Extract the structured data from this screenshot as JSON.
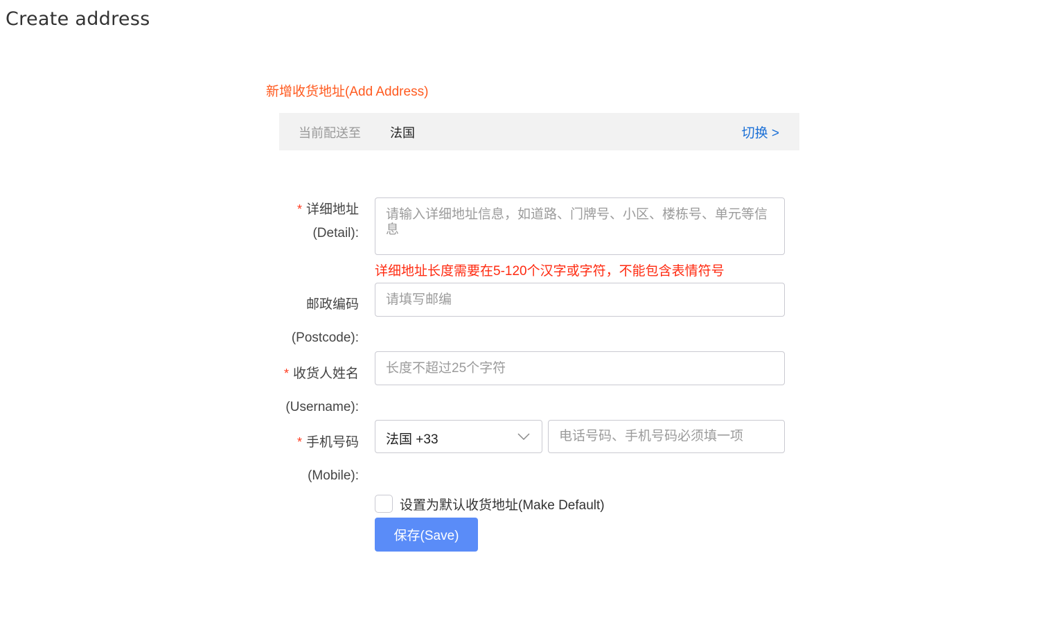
{
  "page": {
    "title": "Create address"
  },
  "form": {
    "section_title": "新增收货地址(Add Address)",
    "shipping": {
      "label": "当前配送至",
      "country": "法国",
      "switch_label": "切换 >"
    },
    "detail": {
      "required_mark": "*",
      "label_cn": "详细地址",
      "label_en": "(Detail):",
      "value": "",
      "placeholder": "请输入详细地址信息，如道路、门牌号、小区、楼栋号、单元等信息",
      "error": "详细地址长度需要在5-120个汉字或字符，不能包含表情符号"
    },
    "postcode": {
      "label_cn": "邮政编码",
      "label_en": "(Postcode):",
      "value": "",
      "placeholder": "请填写邮编"
    },
    "username": {
      "required_mark": "*",
      "label_cn": "收货人姓名",
      "label_en": "(Username):",
      "value": "",
      "placeholder": "长度不超过25个字符"
    },
    "mobile": {
      "required_mark": "*",
      "label_cn": "手机号码",
      "label_en": "(Mobile):",
      "country_code_selected": "法国 +33",
      "value": "",
      "placeholder": "电话号码、手机号码必须填一项"
    },
    "make_default": {
      "label": "设置为默认收货地址(Make Default)",
      "checked": false
    },
    "save_label": "保存(Save)"
  },
  "colors": {
    "section_title": "#ff5a1f",
    "error": "#ff2a10",
    "link": "#1a6fd6",
    "primary_button": "#5a8cf8"
  }
}
